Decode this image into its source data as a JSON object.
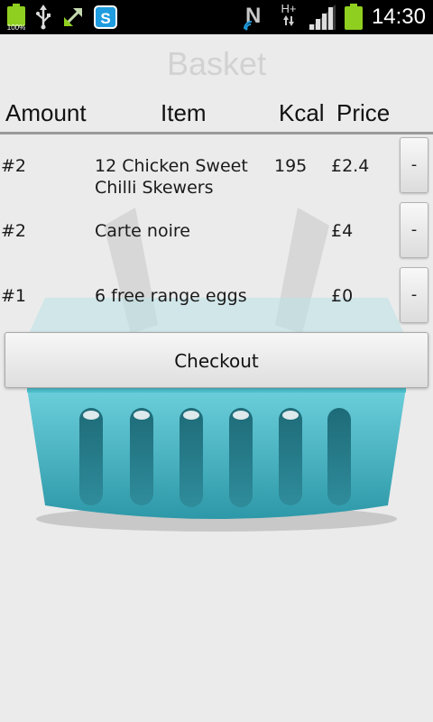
{
  "status_bar": {
    "battery_small_percent": "100%",
    "time": "14:30",
    "network": "H+",
    "skype_letter": "S",
    "n_letter": "N"
  },
  "page": {
    "title": "Basket"
  },
  "table": {
    "headers": {
      "amount": "Amount",
      "item": "Item",
      "kcal": "Kcal",
      "price": "Price"
    },
    "rows": [
      {
        "amount": "#2",
        "item_line1": "12 Chicken Sweet",
        "item_line2": "Chilli Skewers",
        "kcal": "195",
        "price": "£2.4",
        "remove": "-"
      },
      {
        "amount": "#2",
        "item_line1": "Carte noire",
        "item_line2": "",
        "kcal": "",
        "price": "£4",
        "remove": "-"
      },
      {
        "amount": "#1",
        "item_line1": "6 free range eggs",
        "item_line2": "",
        "kcal": "",
        "price": "£0",
        "remove": "-"
      }
    ]
  },
  "actions": {
    "checkout": "Checkout"
  },
  "colors": {
    "basket": "#3fb4c4",
    "battery": "#8fcf20"
  }
}
